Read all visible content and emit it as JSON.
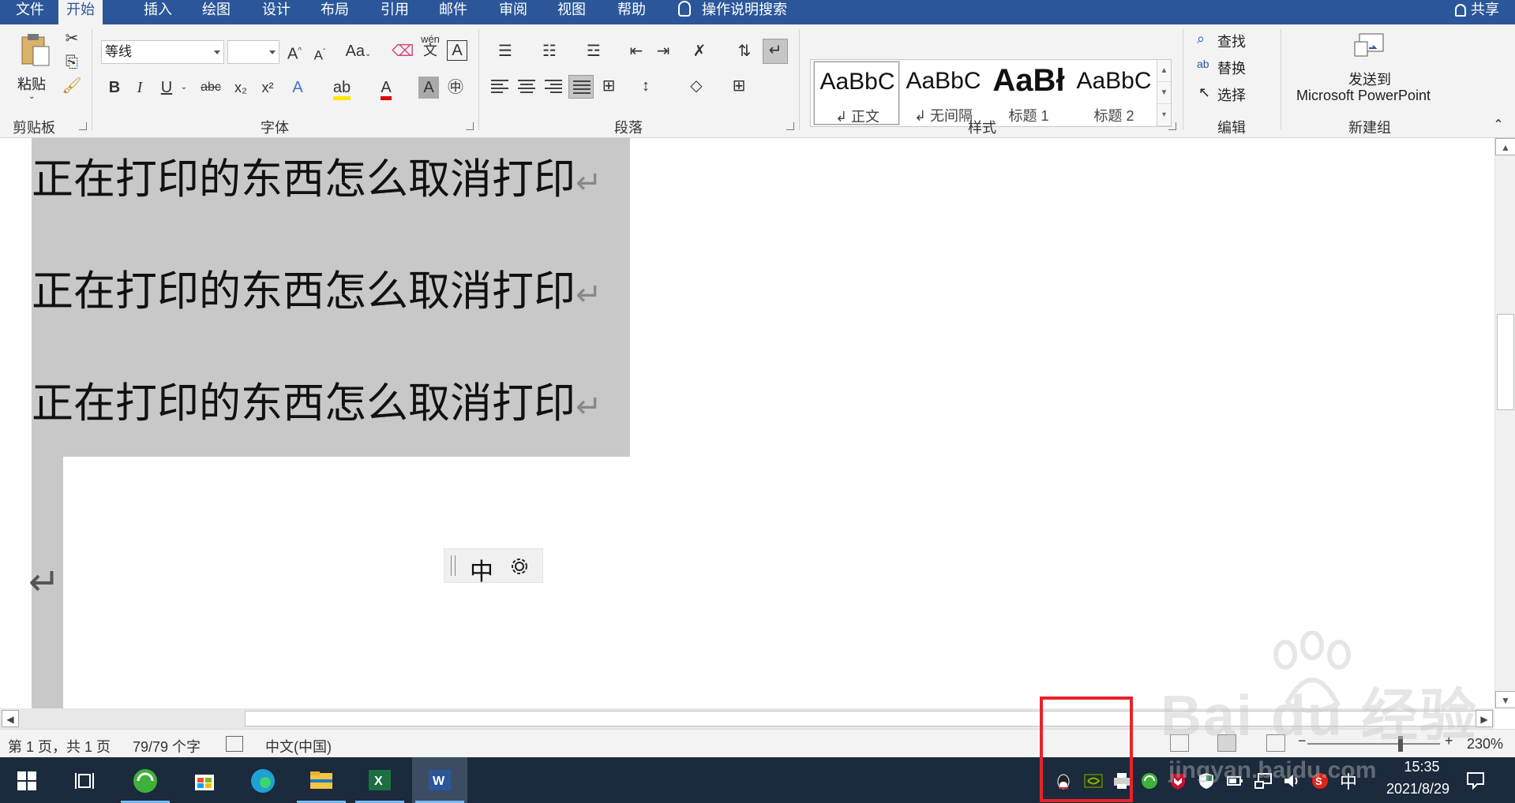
{
  "ribbon_tabs": [
    "文件",
    "开始",
    "插入",
    "绘图",
    "设计",
    "布局",
    "引用",
    "邮件",
    "审阅",
    "视图",
    "帮助"
  ],
  "active_tab": "开始",
  "tell_me": "操作说明搜索",
  "share_label": "共享",
  "clipboard": {
    "paste": "粘贴",
    "group": "剪贴板"
  },
  "font": {
    "name": "等线",
    "size": "",
    "grow": "A",
    "shrink": "A",
    "case": "Aa",
    "bold": "B",
    "italic": "I",
    "underline": "U",
    "strike": "abc",
    "sub": "x₂",
    "sup": "x²",
    "phonetic_top": "wén",
    "phonetic_bottom": "文",
    "box": "A",
    "group": "字体"
  },
  "paragraph": {
    "group": "段落"
  },
  "styles": {
    "group": "样式",
    "items": [
      {
        "sample": "AaBbC",
        "name": "↲ 正文"
      },
      {
        "sample": "AaBbC",
        "name": "↲ 无间隔"
      },
      {
        "sample": "AaBł",
        "name": "标题 1"
      },
      {
        "sample": "AaBbC",
        "name": "标题 2"
      }
    ]
  },
  "editing": {
    "find": "查找",
    "replace": "替换",
    "select": "选择",
    "group": "编辑"
  },
  "new_group": {
    "line1": "发送到",
    "line2": "Microsoft PowerPoint",
    "group": "新建组"
  },
  "document": {
    "lines": [
      "正在打印的东西怎么取消打印",
      "正在打印的东西怎么取消打印",
      "正在打印的东西怎么取消打印"
    ],
    "para_mark": "↵"
  },
  "ime": {
    "mode": "中"
  },
  "status": {
    "page": "第 1 页，共 1 页",
    "words": "79/79 个字",
    "language": "中文(中国)",
    "zoom": "230%",
    "zoom_level": 0.7
  },
  "taskbar": {
    "tray_language": "中",
    "time": "15:35",
    "date": "2021/8/29"
  },
  "watermark": {
    "brand": "Bai du 经验",
    "url": "jingyan.baidu.com"
  },
  "colors": {
    "accent": "#2b579a",
    "selection": "#c8c8c8",
    "taskbar": "#1b2a3c",
    "highlight": "#e8232a"
  }
}
